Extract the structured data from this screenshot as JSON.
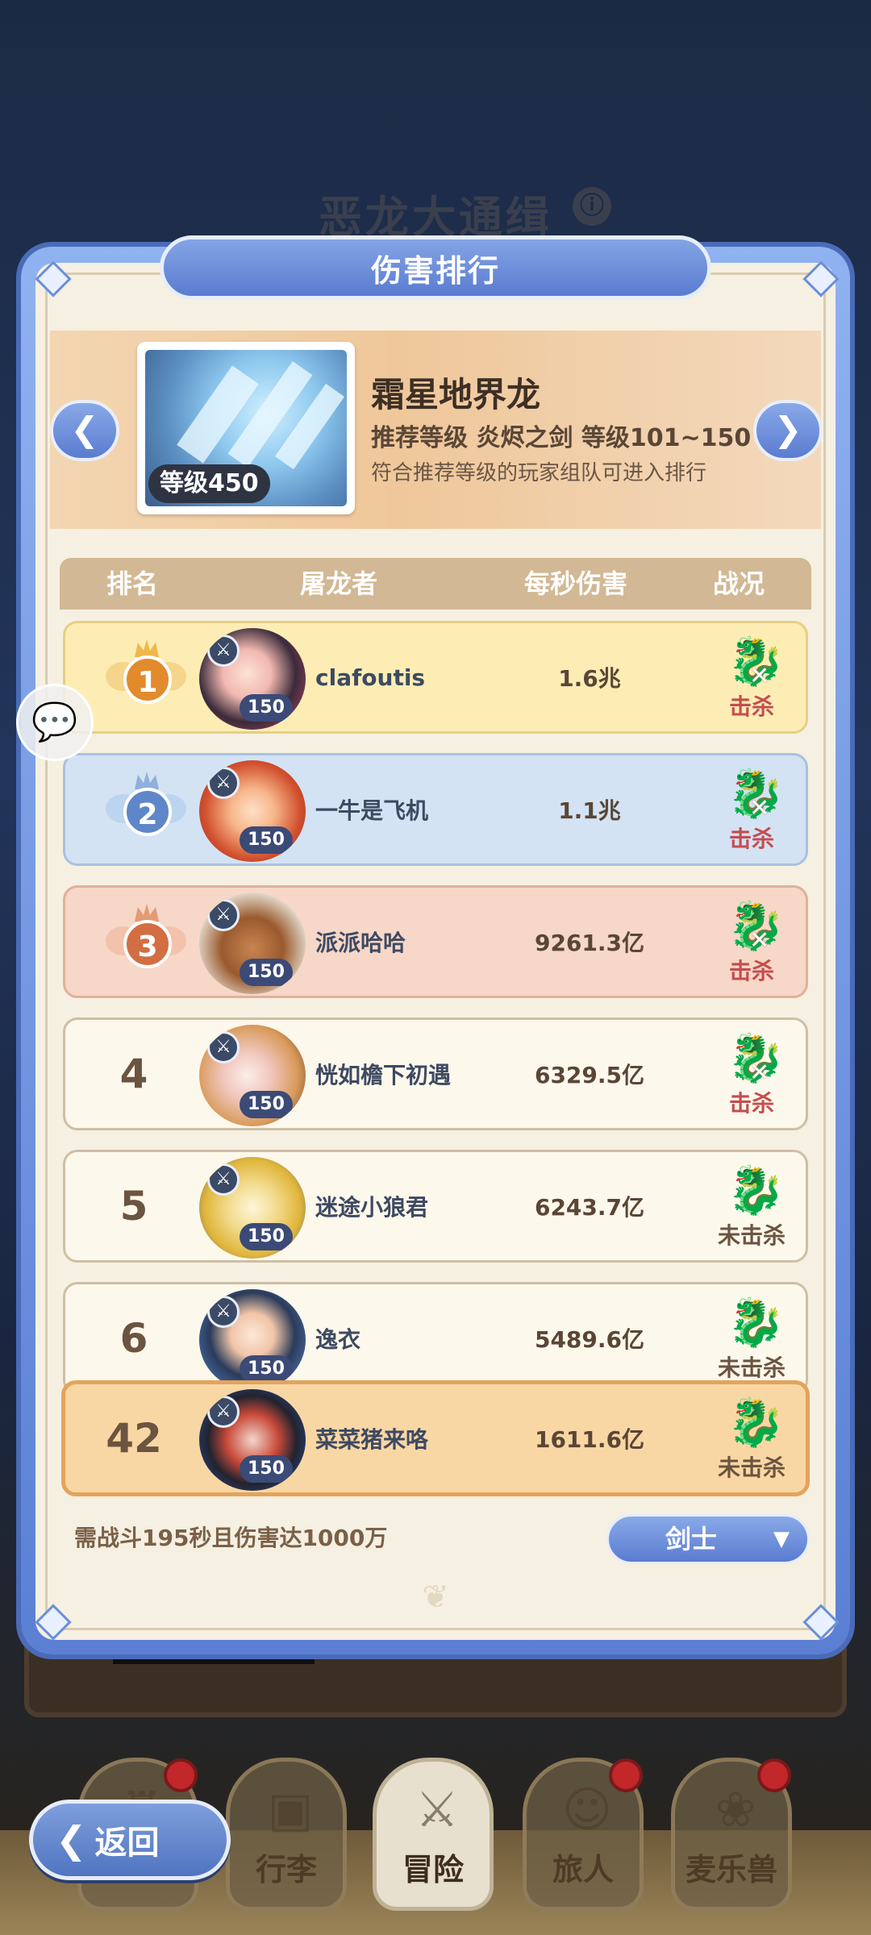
{
  "background": {
    "title": "恶龙大通缉",
    "info_icon": "ⓘ",
    "tabs": [
      {
        "label": "",
        "icon": "castle-icon",
        "badge": true
      },
      {
        "label": "行李",
        "icon": "backpack-icon",
        "badge": false
      },
      {
        "label": "冒险",
        "icon": "crossed-swords-icon",
        "badge": false,
        "active": true
      },
      {
        "label": "旅人",
        "icon": "traveler-icon",
        "badge": true
      },
      {
        "label": "麦乐兽",
        "icon": "pet-icon",
        "badge": true
      }
    ]
  },
  "back_button": {
    "label": "返回",
    "icon": "chevron-left-icon"
  },
  "modal": {
    "title": "伤害排行",
    "prev_icon": "chevron-left-icon",
    "next_icon": "chevron-right-icon",
    "boss": {
      "name": "霜星地界龙",
      "level": "等级450",
      "recommend": "推荐等级 炎烬之剑 等级101~150",
      "note": "符合推荐等级的玩家组队可进入排行",
      "portrait": "ice-dragon-portrait"
    },
    "table": {
      "headers": {
        "rank": "排名",
        "slayer": "屠龙者",
        "dps": "每秒伤害",
        "status": "战况"
      },
      "rows": [
        {
          "rank": "1",
          "name": "clafoutis",
          "level": "150",
          "dps": "1.6兆",
          "status": "击杀",
          "killed": true,
          "medal": "gold",
          "style": "rank1"
        },
        {
          "rank": "2",
          "name": "一牛是飞机",
          "level": "150",
          "dps": "1.1兆",
          "status": "击杀",
          "killed": true,
          "medal": "silver",
          "style": "rank2"
        },
        {
          "rank": "3",
          "name": "派派哈哈",
          "level": "150",
          "dps": "9261.3亿",
          "status": "击杀",
          "killed": true,
          "medal": "bronze",
          "style": "rank3"
        },
        {
          "rank": "4",
          "name": "恍如檐下初遇",
          "level": "150",
          "dps": "6329.5亿",
          "status": "击杀",
          "killed": true,
          "style": "normal"
        },
        {
          "rank": "5",
          "name": "迷途小狼君",
          "level": "150",
          "dps": "6243.7亿",
          "status": "未击杀",
          "killed": false,
          "style": "normal"
        },
        {
          "rank": "6",
          "name": "逸衣",
          "level": "150",
          "dps": "5489.6亿",
          "status": "未击杀",
          "killed": false,
          "style": "normal"
        }
      ],
      "self_row": {
        "rank": "42",
        "name": "菜菜猪来咯",
        "level": "150",
        "dps": "1611.6亿",
        "status": "未击杀",
        "killed": false
      }
    },
    "requirement": "需战斗195秒且伤害达1000万",
    "class_select": {
      "value": "剑士",
      "arrow": "▼"
    }
  },
  "chat_icon": "chat-bubble-icon",
  "colors": {
    "accent_blue": "#5a7cd0",
    "panel_bg": "#f6f0e2",
    "killed_red": "#c44d4f",
    "rank1_bg": "#fdedb5",
    "rank2_bg": "#d3e3f4",
    "rank3_bg": "#f6d7c8",
    "self_bg": "#f9d7a4"
  }
}
